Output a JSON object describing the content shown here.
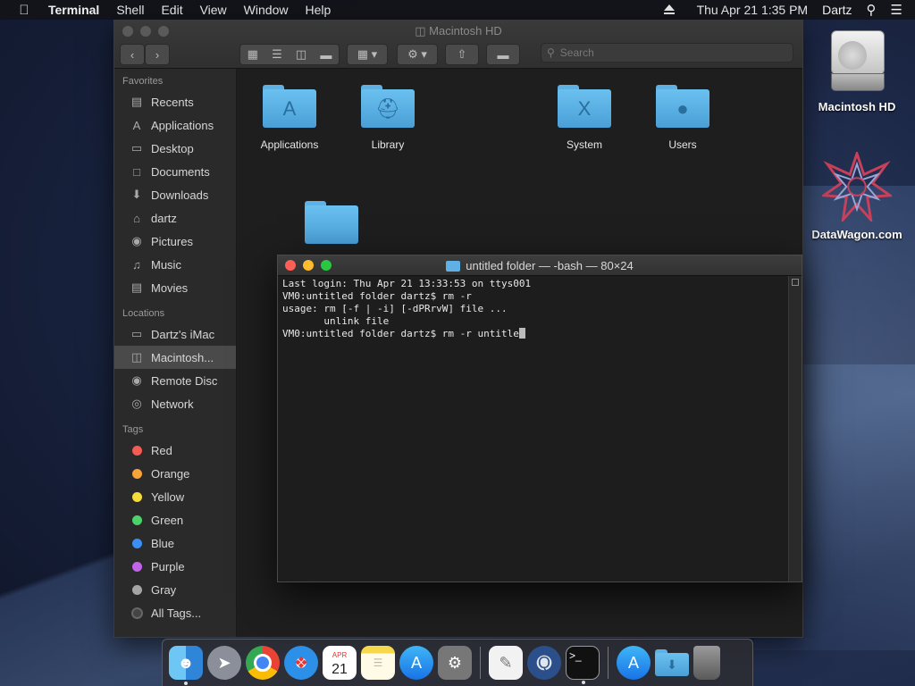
{
  "menubar": {
    "apple": "",
    "app_name": "Terminal",
    "items": [
      "Shell",
      "Edit",
      "View",
      "Window",
      "Help"
    ],
    "clock": "Thu Apr 21  1:35 PM",
    "user": "Dartz"
  },
  "finder": {
    "title": "Macintosh HD",
    "search_placeholder": "Search",
    "favorites_label": "Favorites",
    "favorites": [
      "Recents",
      "Applications",
      "Desktop",
      "Documents",
      "Downloads",
      "dartz",
      "Pictures",
      "Music",
      "Movies"
    ],
    "locations_label": "Locations",
    "locations": [
      "Dartz's iMac",
      "Macintosh...",
      "Remote Disc",
      "Network"
    ],
    "tags_label": "Tags",
    "tags": [
      {
        "name": "Red",
        "color": "#f25c54"
      },
      {
        "name": "Orange",
        "color": "#f5a33b"
      },
      {
        "name": "Yellow",
        "color": "#f5dc3b"
      },
      {
        "name": "Green",
        "color": "#4ed06a"
      },
      {
        "name": "Blue",
        "color": "#3c8ff0"
      },
      {
        "name": "Purple",
        "color": "#c065e8"
      },
      {
        "name": "Gray",
        "color": "#a5a5a5"
      },
      {
        "name": "All Tags...",
        "color": "#444444"
      }
    ],
    "files": [
      "Applications",
      "Library",
      "System",
      "Users"
    ]
  },
  "terminal": {
    "title": "untitled folder — -bash — 80×24",
    "lines": [
      "Last login: Thu Apr 21 13:33:53 on ttys001",
      "VM0:untitled folder dartz$ rm -r",
      "usage: rm [-f | -i] [-dPRrvW] file ...",
      "       unlink file",
      "VM0:untitled folder dartz$ rm -r untitle"
    ]
  },
  "desktop": {
    "icons": [
      "Macintosh HD",
      "DataWagon.com"
    ]
  },
  "dock": {
    "apps": [
      "Finder",
      "Launchpad",
      "Chrome",
      "Safari",
      "Calendar",
      "Notes",
      "App Store",
      "System Preferences",
      "TextEdit",
      "QuickTime",
      "Terminal",
      "Applications",
      "Downloads",
      "Trash"
    ],
    "calendar_month": "APR",
    "calendar_day": "21"
  },
  "colors": {
    "close": "#ff5f57",
    "minimize": "#febc2e",
    "zoom": "#28c840",
    "folder": "#5fb1e4"
  }
}
